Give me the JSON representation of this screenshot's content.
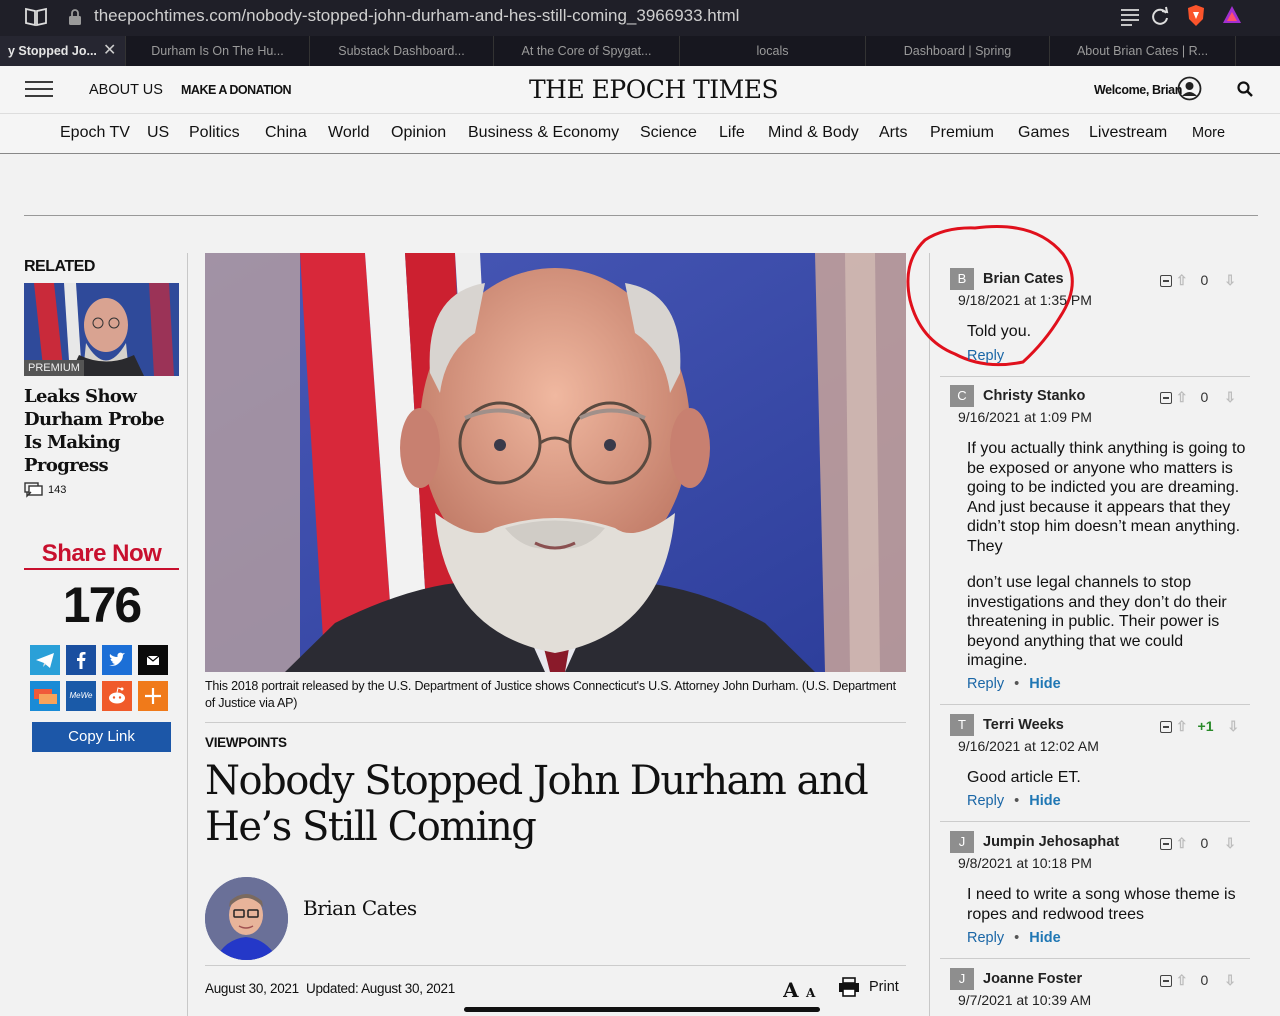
{
  "browser": {
    "url": "theepochtimes.com/nobody-stopped-john-durham-and-hes-still-coming_3966933.html",
    "tabs": [
      "y Stopped Jo...",
      "Durham Is On The Hu...",
      "Substack Dashboard...",
      "At the Core of Spygat...",
      "locals",
      "Dashboard | Spring",
      "About Brian Cates | R..."
    ]
  },
  "header": {
    "about": "ABOUT US",
    "donate": "MAKE A DONATION",
    "logo": "THE EPOCH TIMES",
    "welcome": "Welcome, Brian"
  },
  "nav": [
    "Epoch TV",
    "US",
    "Politics",
    "China",
    "World",
    "Opinion",
    "Business & Economy",
    "Science",
    "Life",
    "Mind & Body",
    "Arts",
    "Premium",
    "Games",
    "Livestream",
    "More"
  ],
  "related": {
    "heading": "RELATED",
    "badge": "PREMIUM",
    "title": "Leaks Show Durham Probe Is Making Progress",
    "comment_count": "143"
  },
  "share": {
    "heading": "Share Now",
    "count": "176",
    "copy_link": "Copy Link",
    "mewe": "MeWe"
  },
  "article": {
    "caption": "This 2018 portrait released by the U.S. Department of Justice shows Connecticut's U.S. Attorney John Durham. (U.S. Department of Justice via AP)",
    "category": "VIEWPOINTS",
    "title": "Nobody Stopped John Durham and He’s Still Coming",
    "author": "Brian Cates",
    "date": "August 30, 2021",
    "updated": "Updated: August 30, 2021",
    "print": "Print"
  },
  "comments": [
    {
      "initial": "B",
      "name": "Brian Cates",
      "date": "9/18/2021 at 1:35 PM",
      "text": [
        "Told you."
      ],
      "score": "0",
      "reply": "Reply",
      "hide": ""
    },
    {
      "initial": "C",
      "name": "Christy Stanko",
      "date": "9/16/2021 at 1:09 PM",
      "text": [
        "If you actually think anything is going to be exposed or anyone who matters is going to be indicted you are dreaming. And just because it appears that they didn’t stop him doesn’t mean anything. They",
        "don’t use legal channels to stop investigations and they don’t do their threatening in public. Their power is beyond anything that we could imagine."
      ],
      "score": "0",
      "reply": "Reply",
      "hide": "Hide"
    },
    {
      "initial": "T",
      "name": "Terri Weeks",
      "date": "9/16/2021 at 12:02 AM",
      "text": [
        "Good article ET."
      ],
      "score": "+1",
      "reply": "Reply",
      "hide": "Hide"
    },
    {
      "initial": "J",
      "name": "Jumpin Jehosaphat",
      "date": "9/8/2021 at 10:18 PM",
      "text": [
        "I need to write a song whose theme is ropes and redwood trees"
      ],
      "score": "0",
      "reply": "Reply",
      "hide": "Hide"
    },
    {
      "initial": "J",
      "name": "Joanne Foster",
      "date": "9/7/2021 at 10:39 AM",
      "text": [],
      "score": "0",
      "reply": "",
      "hide": ""
    }
  ],
  "colors": {
    "share_red": "#c8102e",
    "copy_link_blue": "#1c57a8",
    "annotation_red": "#e0101c",
    "link_blue": "#1a66a6"
  }
}
